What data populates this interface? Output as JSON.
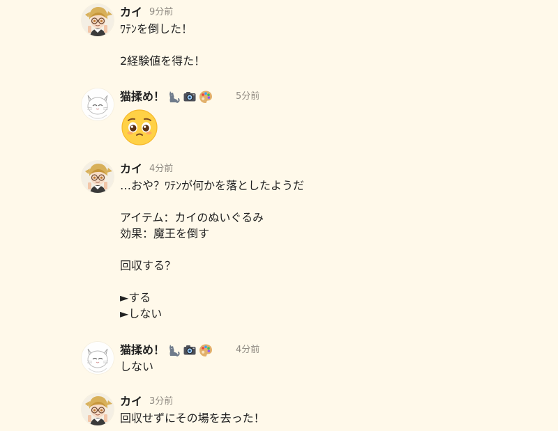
{
  "messages": [
    {
      "author": "カイ",
      "time": "9分前",
      "lines": [
        "ﾜﾃﾝを倒した！",
        "",
        "2経験値を得た！"
      ]
    },
    {
      "author": "猫揉め！",
      "badges": [
        "cat-icon",
        "camera-icon",
        "palette-icon"
      ],
      "time": "5分前",
      "emoji": "pleading-face-icon"
    },
    {
      "author": "カイ",
      "time": "4分前",
      "lines": [
        "…おや？ﾜﾃﾝが何かを落としたようだ",
        "",
        "アイテム：カイのぬいぐるみ",
        "効果：魔王を倒す",
        "",
        "回収する？",
        "",
        "►する",
        "►しない"
      ]
    },
    {
      "author": "猫揉め！",
      "badges": [
        "cat-icon",
        "camera-icon",
        "palette-icon"
      ],
      "time": "4分前",
      "lines": [
        "しない"
      ]
    },
    {
      "author": "カイ",
      "time": "3分前",
      "lines": [
        "回収せずにその場を去った！"
      ]
    }
  ],
  "colors": {
    "background": "#fff9ea",
    "text": "#222222",
    "timestamp": "#8f8a82"
  }
}
